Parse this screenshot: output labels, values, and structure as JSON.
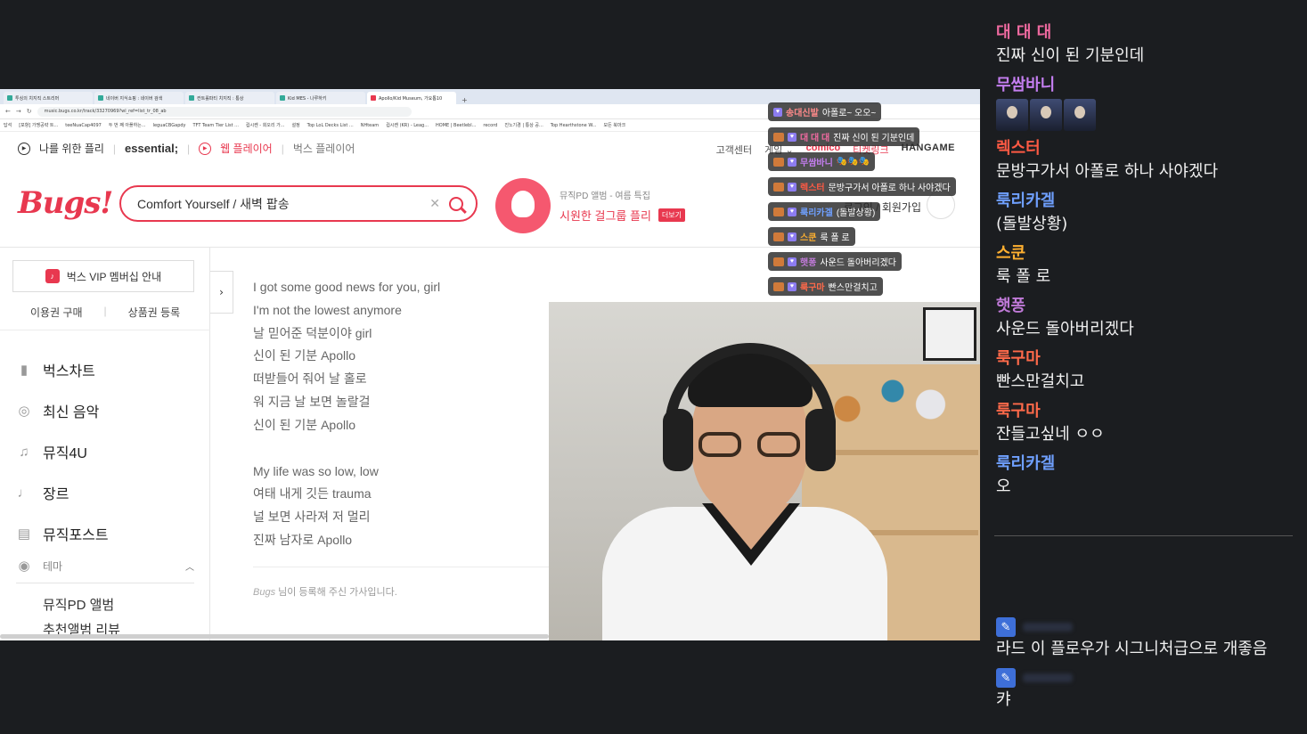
{
  "browser": {
    "tabs": [
      {
        "label": "투싱의 치지직 스트리머"
      },
      {
        "label": "네이버 지식쇼핑 : 네이버 검색"
      },
      {
        "label": "컨트롤파티 치지직 : 통상"
      },
      {
        "label": "Kid MES - 나루하키"
      },
      {
        "label": "Apollo/Kid Museum, 가요톱10"
      }
    ],
    "new_tab": "+",
    "url": "music.bugs.co.kr/track/33270969?wl_ref=list_tr_08_ab",
    "bookmarks": [
      "답석",
      "[포항] 가맹공략 트...",
      "teeNuaCap4097",
      "두 번 째 아플하는...",
      "leguaCBGapdy",
      "TFT Team Tier List ...",
      "컵시켄 - 회오리 가...",
      "설정",
      "Top LoL Decks List ...",
      "NHteam",
      "컵시켄 (KR) - Leag...",
      "HOME | Beetlebl...",
      "record",
      "진노기경 | 통상 공...",
      "Top Hearthstone W...",
      "모든 북마크"
    ]
  },
  "bugs": {
    "topnav": {
      "my_playlist": "나를 위한 플리",
      "essential": "essential;",
      "web_player": "웹 플레이어",
      "bugs_player": "벅스 플레이어"
    },
    "rightnav": {
      "support": "고객센터",
      "game": "게임",
      "comico": "comico",
      "ticketlink": "티켓링크",
      "hangame": "HANGAME"
    },
    "logo": "Bugs!",
    "search": {
      "value": "Comfort Yourself / 새벽 팝송"
    },
    "promo": {
      "subtitle": "뮤직PD 앨범 - 여름 특집",
      "title": "시원한 걸그룹 플리",
      "badge": "더보기"
    },
    "login": "로그인 / 회원가입",
    "sidebar": {
      "vip": "벅스 VIP 멤버십 안내",
      "links": [
        "이용권 구매",
        "상품권 등록"
      ],
      "items": [
        {
          "label": "벅스차트",
          "icon": "chart-icon"
        },
        {
          "label": "최신 음악",
          "icon": "new-music-icon"
        },
        {
          "label": "뮤직4U",
          "icon": "music-note-icon"
        },
        {
          "label": "장르",
          "icon": "guitar-icon"
        },
        {
          "label": "뮤직포스트",
          "icon": "post-icon"
        }
      ],
      "theme": "테마",
      "theme_items": [
        "뮤직PD 앨범",
        "추천앨범 리뷰"
      ]
    },
    "lyrics": {
      "lines_a": [
        "I got some good news for you, girl",
        "I'm not the lowest anymore",
        "날 믿어준 덕분이야 girl",
        "신이 된 기분 Apollo",
        "떠받들어 줘어 날 홀로",
        "워 지금 날 보면 놀랄걸",
        "신이 된 기분 Apollo"
      ],
      "lines_b": [
        "My life was so low, low",
        "여태 내게 깃든 trauma",
        "널 보면 사라져 저 멀리",
        "진짜 남자로 Apollo"
      ],
      "credit_user": "Bugs",
      "credit_text": "님이 등록해 주신 가사입니다."
    }
  },
  "overlay_chat": [
    {
      "name": "송대신발",
      "text": "아폴로~ 오오~"
    },
    {
      "name": "대 대 대",
      "text": "진짜 신이 된 기분인데"
    },
    {
      "name": "무쌈바니",
      "text": "🎭🎭🎭"
    },
    {
      "name": "렉스터",
      "text": "문방구가서 아폴로 하나 사야겠다"
    },
    {
      "name": "룩리카겔",
      "text": "(돌발상황)"
    },
    {
      "name": "스쿤",
      "text": "룩 폴 로"
    },
    {
      "name": "햇퐁",
      "text": "사운드 돌아버리겠다"
    },
    {
      "name": "룩구마",
      "text": "빤스만걸치고"
    }
  ],
  "chat": {
    "messages": [
      {
        "name": "대 대 대",
        "text": "진짜 신이 된 기분인데",
        "color": "#f06aa0"
      },
      {
        "name": "무쌈바니",
        "text": "",
        "color": "#c47ef0",
        "emotes": 3
      },
      {
        "name": "렉스터",
        "text": "문방구가서 아폴로 하나 사야겠다",
        "color": "#ff5a44"
      },
      {
        "name": "룩리카겔",
        "text": "(돌발상황)",
        "color": "#6fa0ff"
      },
      {
        "name": "스쿤",
        "text": "룩 폴 로",
        "color": "#ffb030"
      },
      {
        "name": "햇퐁",
        "text": "사운드 돌아버리겠다",
        "color": "#c07ad8"
      },
      {
        "name": "룩구마",
        "text": "빤스만걸치고",
        "color": "#ff6a4a"
      },
      {
        "name": "룩구마",
        "text": "잔들고싶네 ㅇㅇ",
        "color": "#ff6a4a"
      },
      {
        "name": "룩리카겔",
        "text": "오",
        "color": "#6fa0ff"
      }
    ],
    "pinned": [
      {
        "text": "라드 이 플로우가 시그니처급으로 개좋음"
      },
      {
        "text": "캬"
      }
    ],
    "mod_badge_color": "#3e6fd8"
  },
  "colors": {
    "brand": "#e8384f",
    "background": "#1b1d20"
  }
}
